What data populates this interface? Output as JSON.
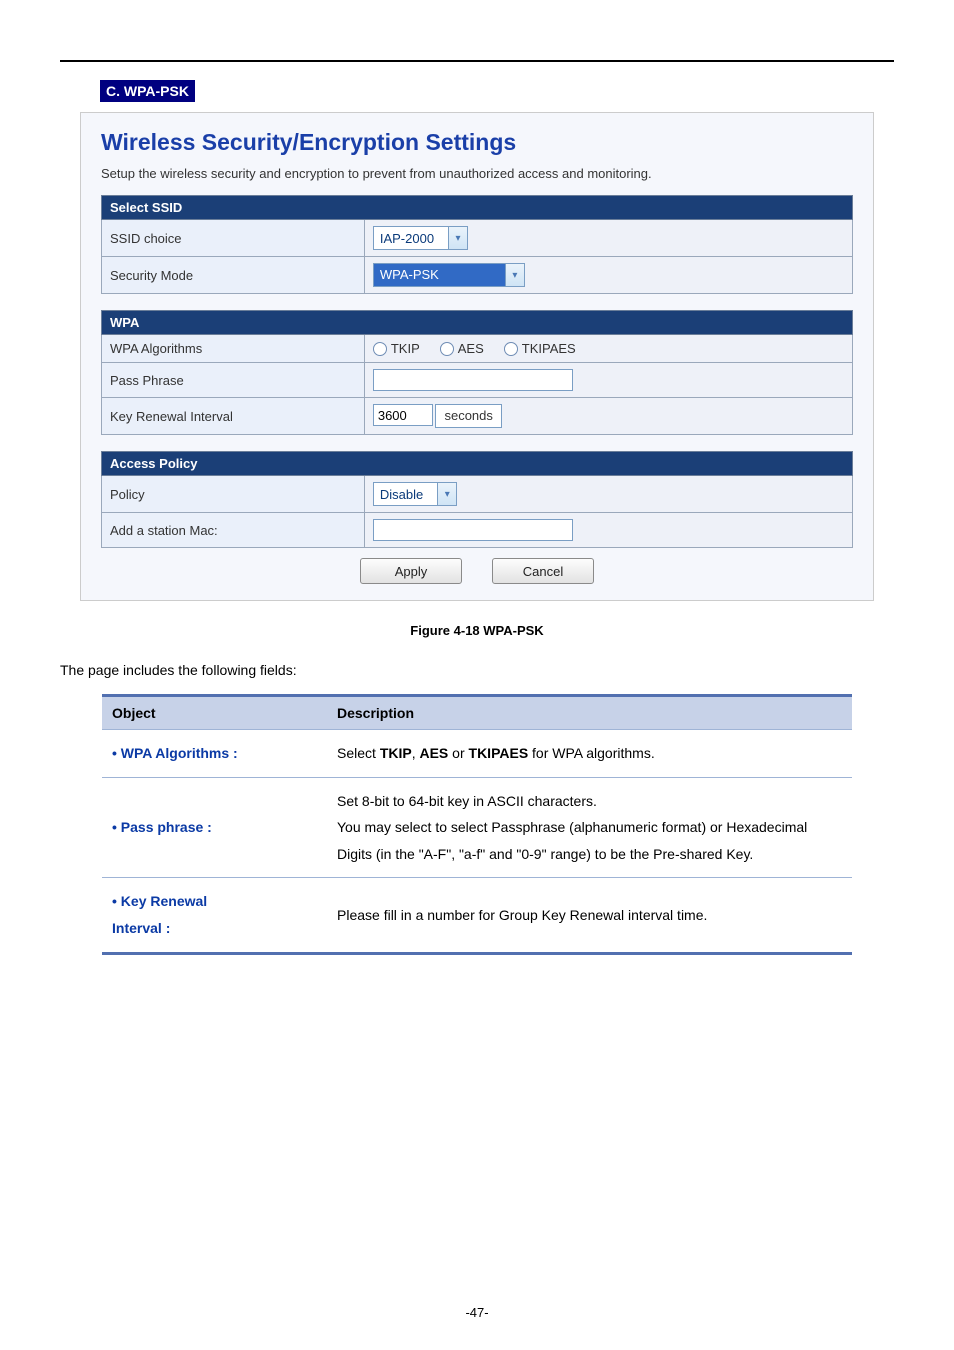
{
  "section_tag": "C. WPA-PSK",
  "panel": {
    "title": "Wireless Security/Encryption Settings",
    "subtitle": "Setup the wireless security and encryption to prevent from unauthorized access and monitoring.",
    "select_ssid_header": "Select SSID",
    "ssid_choice_label": "SSID choice",
    "ssid_choice_value": "IAP-2000",
    "security_mode_label": "Security Mode",
    "security_mode_value": "WPA-PSK",
    "wpa_header": "WPA",
    "wpa_algorithms_label": "WPA Algorithms",
    "wpa_algorithms_options": {
      "tkip": "TKIP",
      "aes": "AES",
      "tkipaes": "TKIPAES"
    },
    "pass_phrase_label": "Pass Phrase",
    "key_renewal_label": "Key Renewal Interval",
    "key_renewal_value": "3600",
    "key_renewal_unit": "seconds",
    "access_policy_header": "Access Policy",
    "policy_label": "Policy",
    "policy_value": "Disable",
    "add_station_label": "Add a station Mac:",
    "apply_label": "Apply",
    "cancel_label": "Cancel"
  },
  "figure_caption": "Figure 4-18 WPA-PSK",
  "intro_text": "The page includes the following fields:",
  "desc_table": {
    "header_object": "Object",
    "header_description": "Description",
    "rows": [
      {
        "object": "WPA Algorithms :",
        "pre": "Select ",
        "b1": "TKIP",
        "sep1": ", ",
        "b2": "AES",
        "sep2": " or ",
        "b3": "TKIPAES",
        "post": " for WPA algorithms."
      },
      {
        "object": "Pass phrase :",
        "line1": "Set 8-bit to 64-bit key in ASCII characters.",
        "line2": "You may select to select Passphrase (alphanumeric format) or Hexadecimal",
        "line3": "Digits (in the \"A-F\", \"a-f\" and \"0-9\" range) to be the Pre-shared Key."
      },
      {
        "object_line1": "Key Renewal",
        "object_line2": "Interval :",
        "desc": "Please fill in a number for Group Key Renewal interval time."
      }
    ]
  },
  "page_number": "-47-"
}
